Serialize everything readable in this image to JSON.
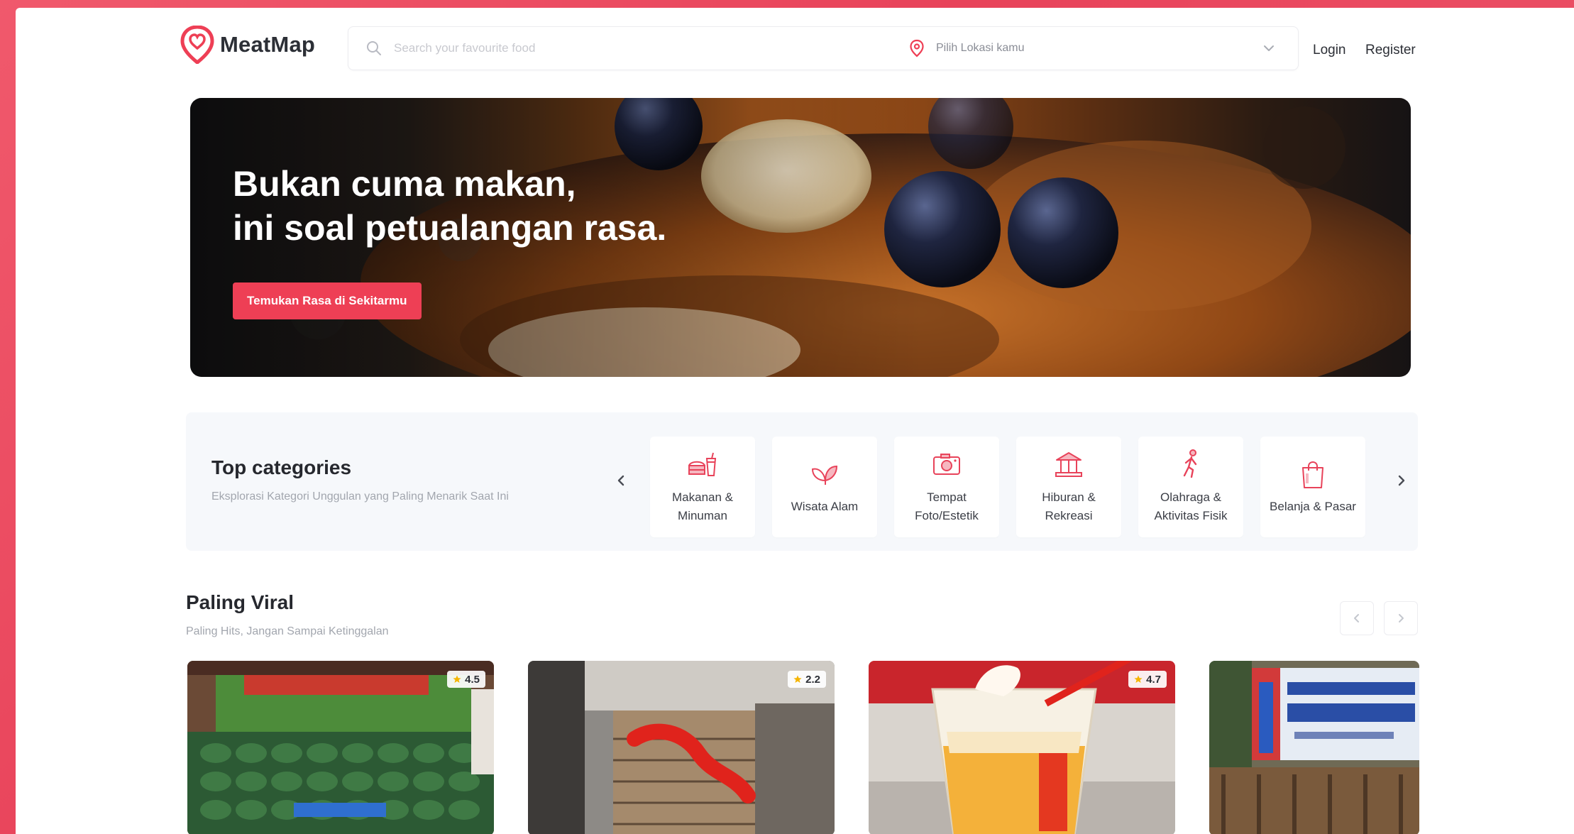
{
  "brand": {
    "name": "MeatMap",
    "accent": "#ee3f55",
    "logo_icon": "map-pin-heart-icon"
  },
  "header": {
    "search_placeholder": "Search your favourite food",
    "location_placeholder": "Pilih Lokasi kamu",
    "login_label": "Login",
    "register_label": "Register"
  },
  "hero": {
    "title_line1": "Bukan cuma makan,",
    "title_line2": "ini soal petualangan rasa.",
    "cta_label": "Temukan Rasa di Sekitarmu"
  },
  "categories": {
    "title": "Top categories",
    "subtitle": "Eksplorasi Kategori Unggulan yang Paling Menarik Saat Ini",
    "items": [
      {
        "label": "Makanan & Minuman",
        "icon": "food-drink-icon"
      },
      {
        "label": "Wisata Alam",
        "icon": "leaf-icon"
      },
      {
        "label": "Tempat Foto/Estetik",
        "icon": "camera-icon"
      },
      {
        "label": "Hiburan & Rekreasi",
        "icon": "carousel-icon"
      },
      {
        "label": "Olahraga & Aktivitas Fisik",
        "icon": "runner-icon"
      },
      {
        "label": "Belanja & Pasar",
        "icon": "shopping-bag-icon"
      }
    ]
  },
  "viral": {
    "title": "Paling Viral",
    "subtitle": "Paling Hits, Jangan Sampai Ketinggalan",
    "cards": [
      {
        "rating": "4.5"
      },
      {
        "rating": "2.2"
      },
      {
        "rating": "4.7"
      },
      {
        "rating": ""
      }
    ]
  }
}
